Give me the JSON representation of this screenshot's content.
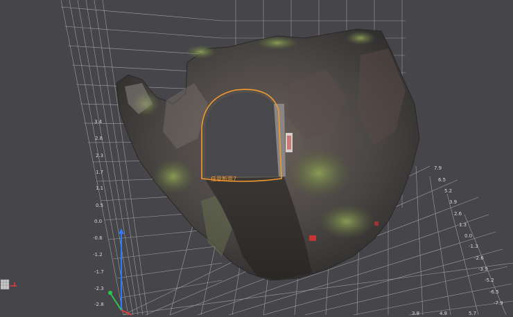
{
  "viewer": {
    "section_label": "任意断面7",
    "colors": {
      "background": "#46464a",
      "grid": "#b8b8bc",
      "section_outline": "#f29a2e",
      "axis_z": "#2f7bff",
      "axis_y": "#28c84a",
      "axis_x": "#e23a3a"
    }
  },
  "axes": {
    "left_ticks": [
      "3.4",
      "2.8",
      "2.3",
      "1.7",
      "1.1",
      "0.5",
      "0.0",
      "-0.6",
      "-1.2",
      "-1.7",
      "-2.3",
      "-2.8"
    ],
    "right_ticks": [
      "7.9",
      "6.5",
      "5.2",
      "3.9",
      "2.6",
      "1.3",
      "0.0",
      "-1.3",
      "-2.6",
      "-3.9",
      "-5.2",
      "-6.5",
      "-7.9"
    ],
    "bottom_ticks": [
      "3.8",
      "4.8",
      "5.7"
    ]
  }
}
